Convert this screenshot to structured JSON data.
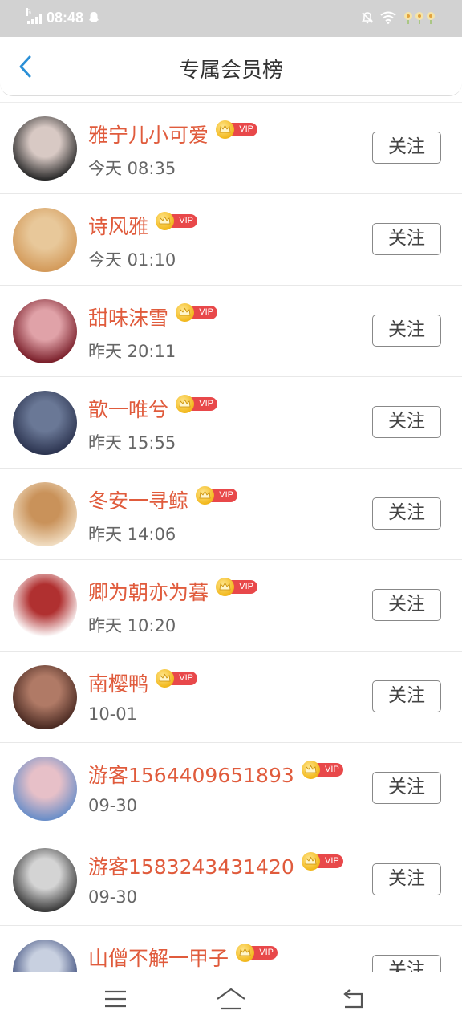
{
  "status_bar": {
    "network": "G",
    "time": "08:48",
    "icons": [
      "signal-icon",
      "snapchat-ghost-icon",
      "mute-bell-icon",
      "wifi-icon",
      "flower-icon"
    ]
  },
  "header": {
    "title": "专属会员榜",
    "back_icon": "chevron-left-icon",
    "accent": "#2a8fd6"
  },
  "members": [
    {
      "name": "雅宁儿小可爱",
      "time": "今天 08:35",
      "follow": "关注",
      "vip": "VIP",
      "avatar_colors": [
        "#2a2a2a",
        "#d8c9c4"
      ]
    },
    {
      "name": "诗风雅",
      "time": "今天 01:10",
      "follow": "关注",
      "vip": "VIP",
      "avatar_colors": [
        "#d39a5a",
        "#e8c89a"
      ]
    },
    {
      "name": "甜味沫雪",
      "time": "昨天 20:11",
      "follow": "关注",
      "vip": "VIP",
      "avatar_colors": [
        "#7a1f2a",
        "#e0a2a8"
      ]
    },
    {
      "name": "歆一唯兮",
      "time": "昨天 15:55",
      "follow": "关注",
      "vip": "VIP",
      "avatar_colors": [
        "#2c3450",
        "#6a7896"
      ]
    },
    {
      "name": "冬安一寻鲸",
      "time": "昨天 14:06",
      "follow": "关注",
      "vip": "VIP",
      "avatar_colors": [
        "#f0dcc0",
        "#c9925a"
      ]
    },
    {
      "name": "卿为朝亦为暮",
      "time": "昨天 10:20",
      "follow": "关注",
      "vip": "VIP",
      "avatar_colors": [
        "#ffffff",
        "#b03030"
      ]
    },
    {
      "name": "南樱鸭",
      "time": "10-01",
      "follow": "关注",
      "vip": "VIP",
      "avatar_colors": [
        "#4a2a22",
        "#b07a66"
      ]
    },
    {
      "name": "游客1564409651893",
      "time": "09-30",
      "follow": "关注",
      "vip": "VIP",
      "avatar_colors": [
        "#6a8ec8",
        "#e7c0c8"
      ]
    },
    {
      "name": "游客1583243431420",
      "time": "09-30",
      "follow": "关注",
      "vip": "VIP",
      "avatar_colors": [
        "#3a3a3a",
        "#d4d4d4"
      ]
    },
    {
      "name": "山僧不解一甲子",
      "time": "",
      "follow": "关注",
      "vip": "VIP",
      "avatar_colors": [
        "#3a4a7a",
        "#c8d0e0"
      ]
    }
  ],
  "colors": {
    "name": "#e05b3c",
    "vip_pill": "#e8484a",
    "crown": "#f2b81c",
    "status_bar_bg": "#d2d2d2"
  },
  "nav_bar": {
    "icons": [
      "menu-icon",
      "home-icon",
      "back-icon"
    ]
  }
}
